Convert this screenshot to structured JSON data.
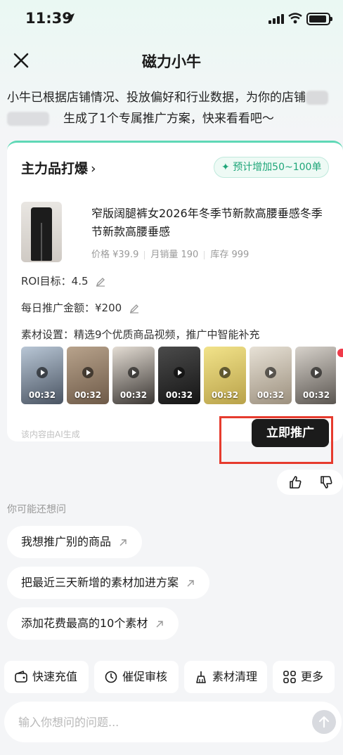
{
  "status_bar": {
    "time": "11:39"
  },
  "nav": {
    "title": "磁力小牛"
  },
  "intro": {
    "line1": "小牛已根据店铺情况、投放偏好和行业数据，为你的店铺",
    "line2": "生成了1个专属推广方案，快来看看吧～"
  },
  "plan_card": {
    "heading": "主力品打爆",
    "badge": "预计增加50~100单",
    "product": {
      "title": "窄版阔腿裤女2026年冬季节新款高腰垂感冬季节新款高腰垂感",
      "price": "价格 ¥39.9",
      "sales": "月销量 190",
      "stock": "库存 999"
    },
    "roi": "ROI目标：4.5",
    "daily_budget": "每日推广金额：¥200",
    "material": "素材设置：精选9个优质商品视频，推广中智能补充",
    "videos": [
      {
        "duration": "00:32"
      },
      {
        "duration": "00:32"
      },
      {
        "duration": "00:32"
      },
      {
        "duration": "00:32"
      },
      {
        "duration": "00:32"
      },
      {
        "duration": "00:32"
      },
      {
        "duration": "00:32"
      }
    ],
    "ai_note": "该内容由AI生成",
    "promote_button": "立即推广"
  },
  "suggestions": {
    "title": "你可能还想问",
    "items": [
      "我想推广别的商品",
      "把最近三天新增的素材加进方案",
      "添加花费最高的10个素材"
    ]
  },
  "toolbar": {
    "items": [
      {
        "label": "快速充值",
        "icon": "wallet-icon"
      },
      {
        "label": "催促审核",
        "icon": "clock-icon"
      },
      {
        "label": "素材清理",
        "icon": "broom-icon"
      },
      {
        "label": "更多",
        "icon": "grid-icon"
      }
    ]
  },
  "input": {
    "placeholder": "输入你想问的问题..."
  },
  "colors": {
    "accent": "#1fa679",
    "highlight_box": "#e63b2e",
    "button_dark": "#1b1b1b"
  }
}
